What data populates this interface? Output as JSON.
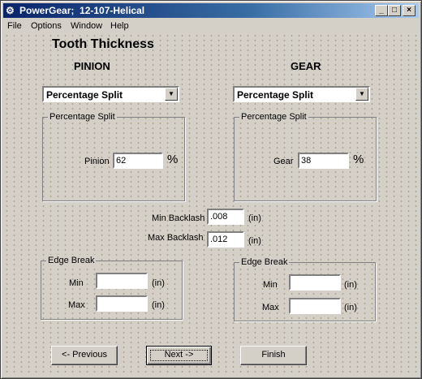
{
  "window": {
    "title": "PowerGear;  12-107-Helical",
    "minimize": "_",
    "maximize": "□",
    "close": "×"
  },
  "menu": [
    "File",
    "Options",
    "Window",
    "Help"
  ],
  "page_title": "Tooth Thickness",
  "pinion": {
    "heading": "PINION",
    "method": "Percentage Split",
    "group_title": "Percentage Split",
    "field_label": "Pinion",
    "value": "62",
    "unit": "%",
    "edge_break": {
      "title": "Edge Break",
      "min_label": "Min",
      "min_value": "",
      "max_label": "Max",
      "max_value": "",
      "unit": "(in)"
    }
  },
  "gear": {
    "heading": "GEAR",
    "method": "Percentage Split",
    "group_title": "Percentage Split",
    "field_label": "Gear",
    "value": "38",
    "unit": "%",
    "edge_break": {
      "title": "Edge Break",
      "min_label": "Min",
      "min_value": "",
      "max_label": "Max",
      "max_value": "",
      "unit": "(in)"
    }
  },
  "backlash": {
    "min_label": "Min Backlash",
    "min_value": ".008",
    "max_label": "Max Backlash",
    "max_value": ".012",
    "unit": "(in)"
  },
  "buttons": {
    "previous": "<- Previous",
    "next": "Next ->",
    "finish": "Finish"
  }
}
